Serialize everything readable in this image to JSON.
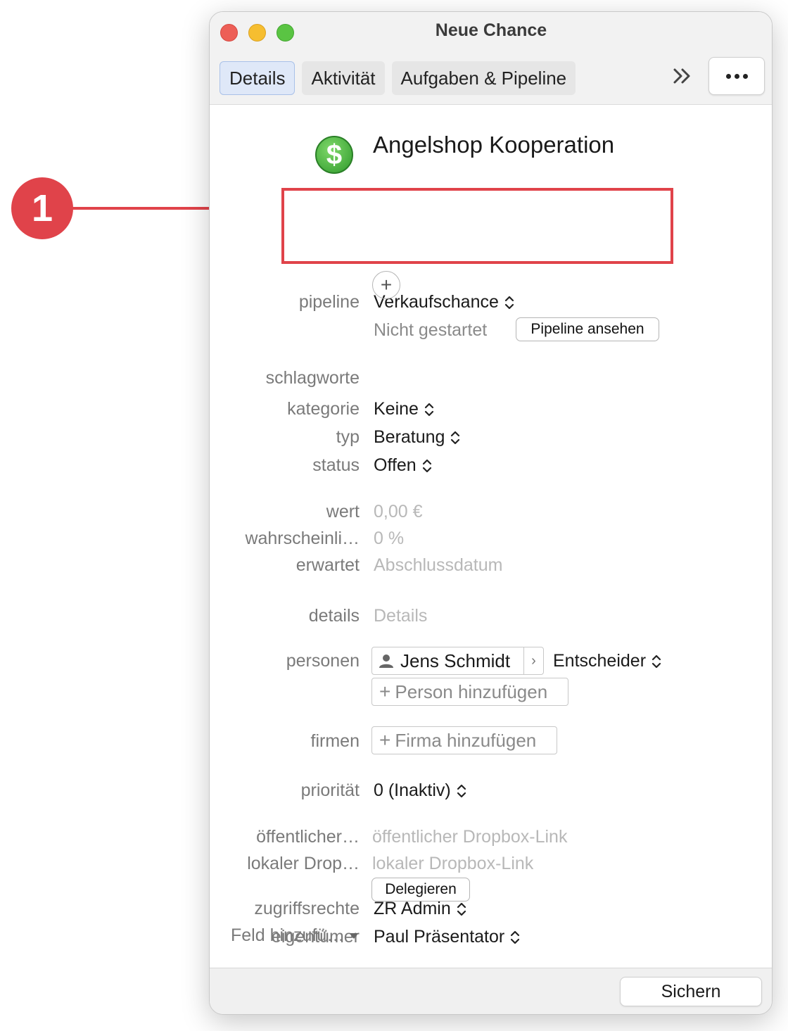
{
  "callout": {
    "number": "1"
  },
  "window": {
    "title": "Neue Chance",
    "tabs": [
      {
        "label": "Details"
      },
      {
        "label": "Aktivität"
      },
      {
        "label": "Aufgaben & Pipeline"
      }
    ]
  },
  "record": {
    "title": "Angelshop Kooperation",
    "icon": "dollar-icon"
  },
  "pipeline": {
    "label": "pipeline",
    "value": "Verkaufschance",
    "stage": "Nicht gestartet",
    "view_button": "Pipeline ansehen"
  },
  "fields": {
    "schlagworte": {
      "label": "schlagworte"
    },
    "kategorie": {
      "label": "kategorie",
      "value": "Keine"
    },
    "typ": {
      "label": "typ",
      "value": "Beratung"
    },
    "status": {
      "label": "status",
      "value": "Offen"
    },
    "wert": {
      "label": "wert",
      "placeholder": "0,00 €"
    },
    "wahrscheinlichkeit": {
      "label": "wahrscheinli…",
      "placeholder": "0 %"
    },
    "erwartet": {
      "label": "erwartet",
      "placeholder": "Abschlussdatum"
    },
    "details": {
      "label": "details",
      "placeholder": "Details"
    },
    "personen": {
      "label": "personen",
      "person": "Jens Schmidt",
      "role": "Entscheider",
      "add": "Person hinzufügen"
    },
    "firmen": {
      "label": "firmen",
      "add": "Firma hinzufügen"
    },
    "prioritaet": {
      "label": "priorität",
      "value": "0 (Inaktiv)"
    },
    "oeffentlich": {
      "label": "öffentlicher…",
      "placeholder": "öffentlicher Dropbox-Link"
    },
    "lokal": {
      "label": "lokaler Drop…",
      "placeholder": "lokaler Dropbox-Link"
    },
    "zugriffsrechte": {
      "label": "zugriffsrechte",
      "value": "ZR Admin"
    },
    "eigentuemer": {
      "label": "eigentümer",
      "value": "Paul Präsentator"
    }
  },
  "delegate_button": "Delegieren",
  "add_field": "Feld hinzufü…",
  "save_button": "Sichern",
  "colors": {
    "callout": "#e0434a",
    "tab_active_bg": "#dfe8f8"
  }
}
